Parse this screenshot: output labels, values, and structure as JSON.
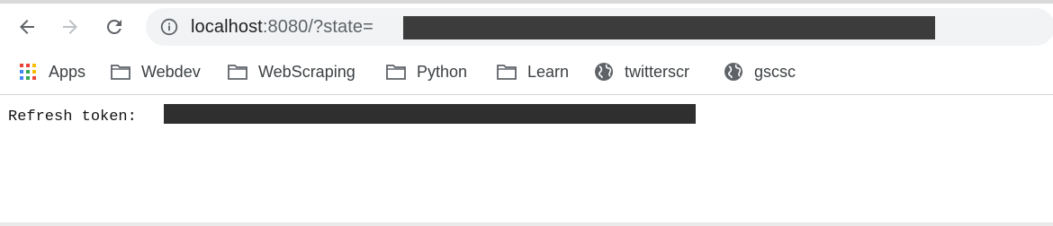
{
  "toolbar": {
    "back_icon": "arrow-left-icon",
    "forward_icon": "arrow-right-icon",
    "reload_icon": "reload-icon",
    "site_info_icon": "info-icon",
    "url_host": "localhost",
    "url_rest": ":8080/?state="
  },
  "bookmarks": [
    {
      "label": "Apps",
      "icon": "apps-grid-icon"
    },
    {
      "label": "Webdev",
      "icon": "folder-icon"
    },
    {
      "label": "WebScraping",
      "icon": "folder-icon"
    },
    {
      "label": "Python",
      "icon": "folder-icon"
    },
    {
      "label": "Learn",
      "icon": "folder-icon"
    },
    {
      "label": "twitterscr",
      "icon": "globe-icon"
    },
    {
      "label": "gscsc",
      "icon": "globe-icon"
    }
  ],
  "page": {
    "token_label": "Refresh token:"
  }
}
